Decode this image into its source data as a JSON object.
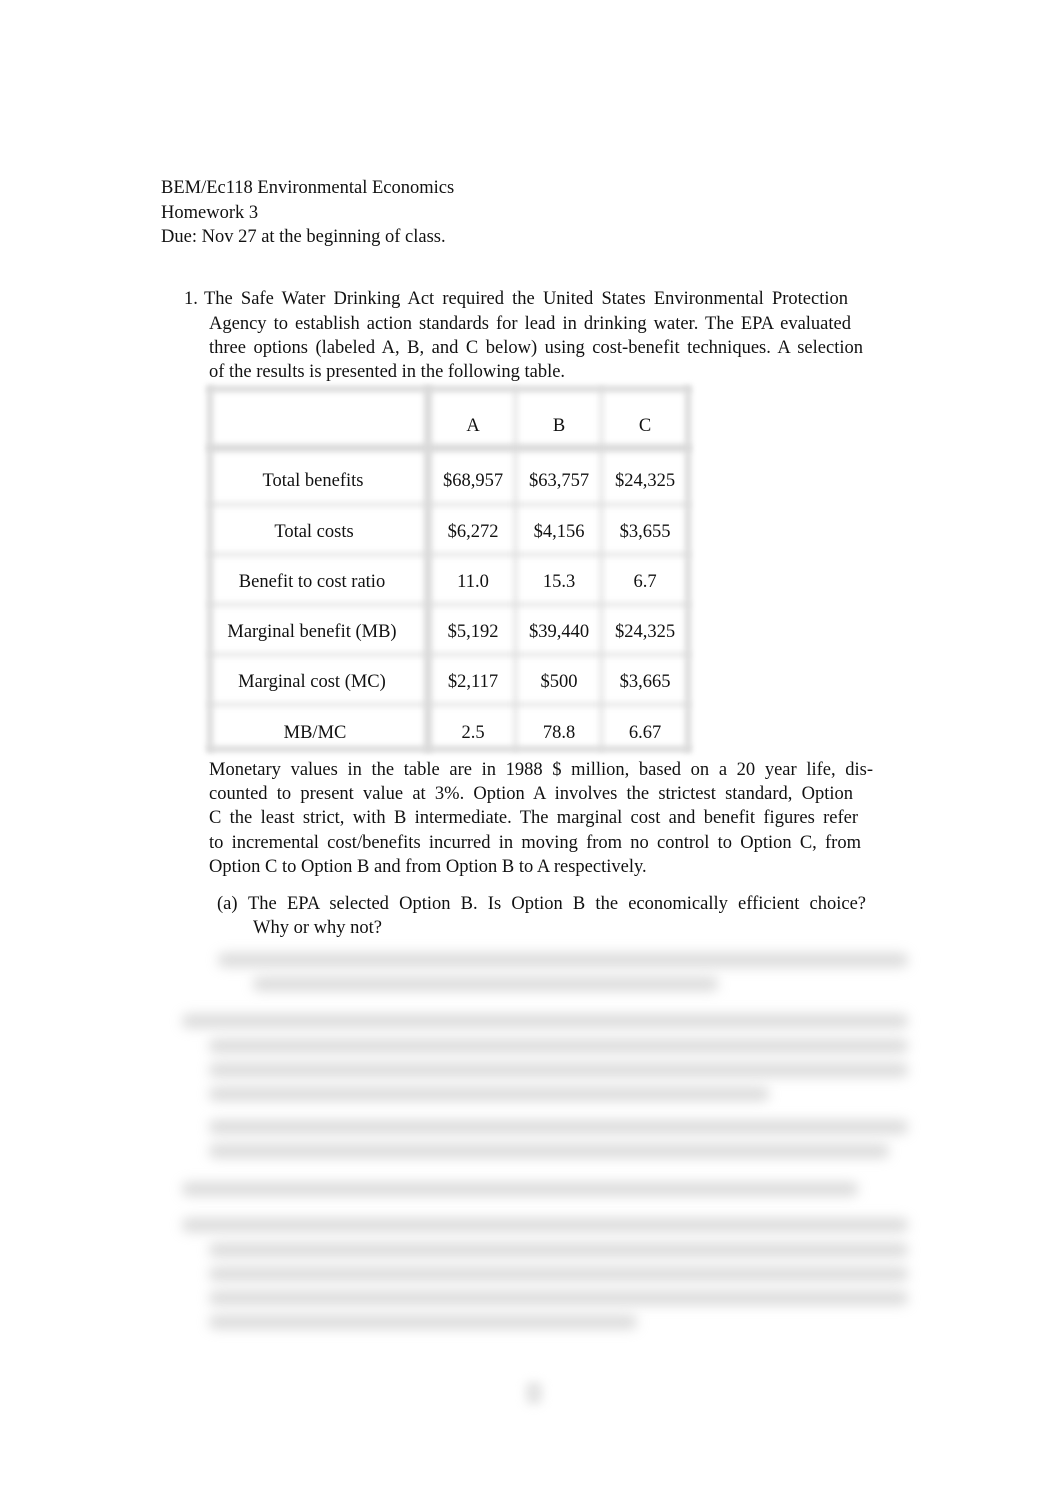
{
  "header": {
    "course": "BEM/Ec118 Environmental Economics",
    "assignment": "Homework 3",
    "due": "Due: Nov 27 at the beginning of class."
  },
  "question1": {
    "number": "1.",
    "intro_lines": [
      "The Safe Water Drinking Act required the United States Environmental Protection",
      "Agency to establish action standards for lead in drinking water. The EPA evaluated",
      "three options (labeled A, B, and C below) using cost-benefit techniques. A selection",
      "of the results is presented in the following table."
    ],
    "table": {
      "columns": [
        "",
        "A",
        "B",
        "C"
      ],
      "rows": [
        {
          "label": "Total benefits",
          "values": [
            "$68,957",
            "$63,757",
            "$24,325"
          ]
        },
        {
          "label": "Total costs",
          "values": [
            "$6,272",
            "$4,156",
            "$3,655"
          ]
        },
        {
          "label": "Benefit to cost ratio",
          "values": [
            "11.0",
            "15.3",
            "6.7"
          ]
        },
        {
          "label": "Marginal benefit (MB)",
          "values": [
            "$5,192",
            "$39,440",
            "$24,325"
          ]
        },
        {
          "label": "Marginal cost (MC)",
          "values": [
            "$2,117",
            "$500",
            "$3,665"
          ]
        },
        {
          "label": "MB/MC",
          "values": [
            "2.5",
            "78.8",
            "6.67"
          ]
        }
      ]
    },
    "note_lines": [
      "Monetary values in the table are in 1988 $ million, based on a 20 year life, dis-",
      "counted to present value at 3%. Option A involves the strictest standard, Option",
      "C the least strict, with B intermediate. The marginal cost and benefit figures refer",
      "to incremental cost/benefits incurred in moving from no control to Option C, from",
      "Option C to Option B and from Option B to A respectively."
    ],
    "part_a": {
      "label": "(a)",
      "lines": [
        "The EPA selected Option B. Is Option B the economically efficient choice?",
        "Why or why not?"
      ]
    }
  }
}
